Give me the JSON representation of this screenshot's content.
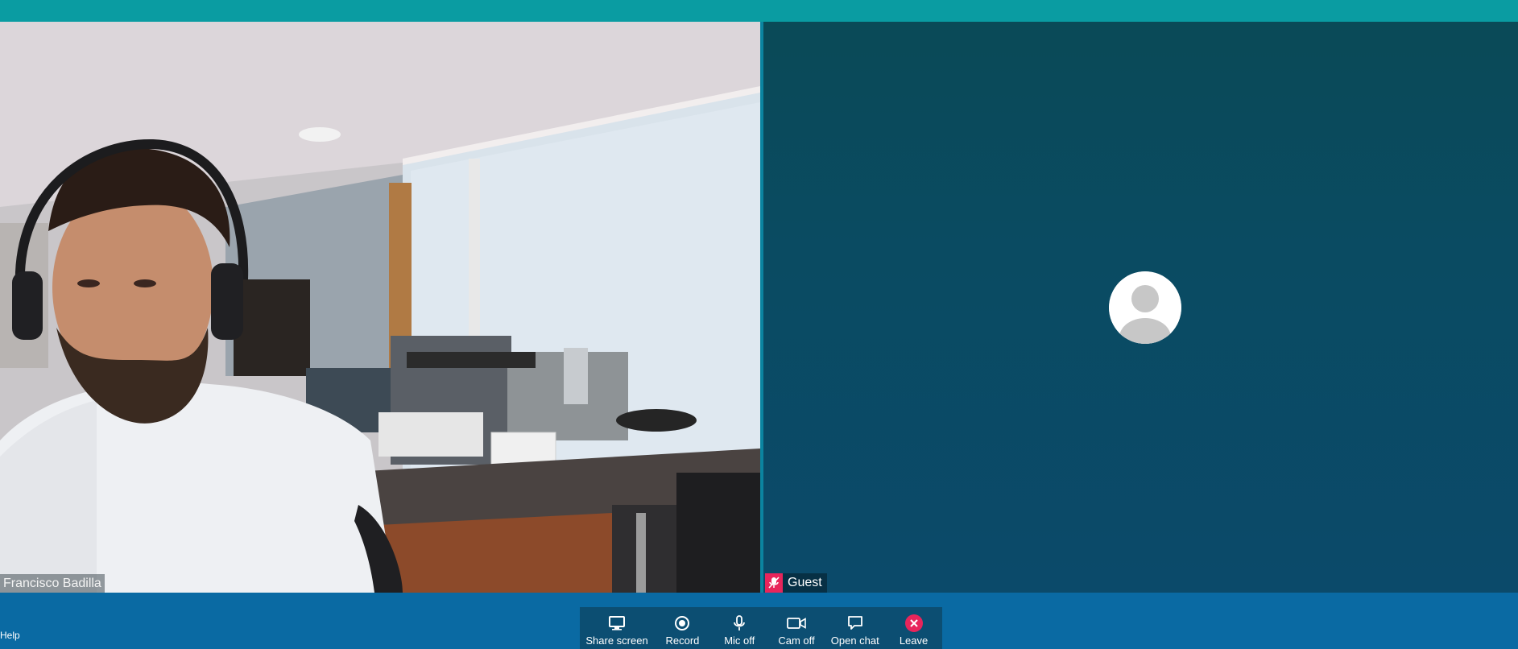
{
  "participants": {
    "local": {
      "name": "Francisco Badilla"
    },
    "remote": {
      "name": "Guest",
      "mic_status": "muted"
    }
  },
  "toolbar": {
    "share_screen": "Share screen",
    "record": "Record",
    "mic_off": "Mic off",
    "cam_off": "Cam off",
    "open_chat": "Open chat",
    "leave": "Leave"
  },
  "footer": {
    "help": "Help"
  },
  "icons": {
    "share_screen": "monitor-icon",
    "record": "record-icon",
    "mic": "microphone-icon",
    "cam": "video-camera-icon",
    "chat": "chat-bubble-icon",
    "leave": "close-icon",
    "muted": "mic-muted-icon",
    "avatar": "user-avatar-icon"
  },
  "colors": {
    "top_bar": "#0a9ca2",
    "toolbar": "#0c4e72",
    "leave_accent": "#e8255b",
    "remote_tile": "#0a4a57"
  }
}
